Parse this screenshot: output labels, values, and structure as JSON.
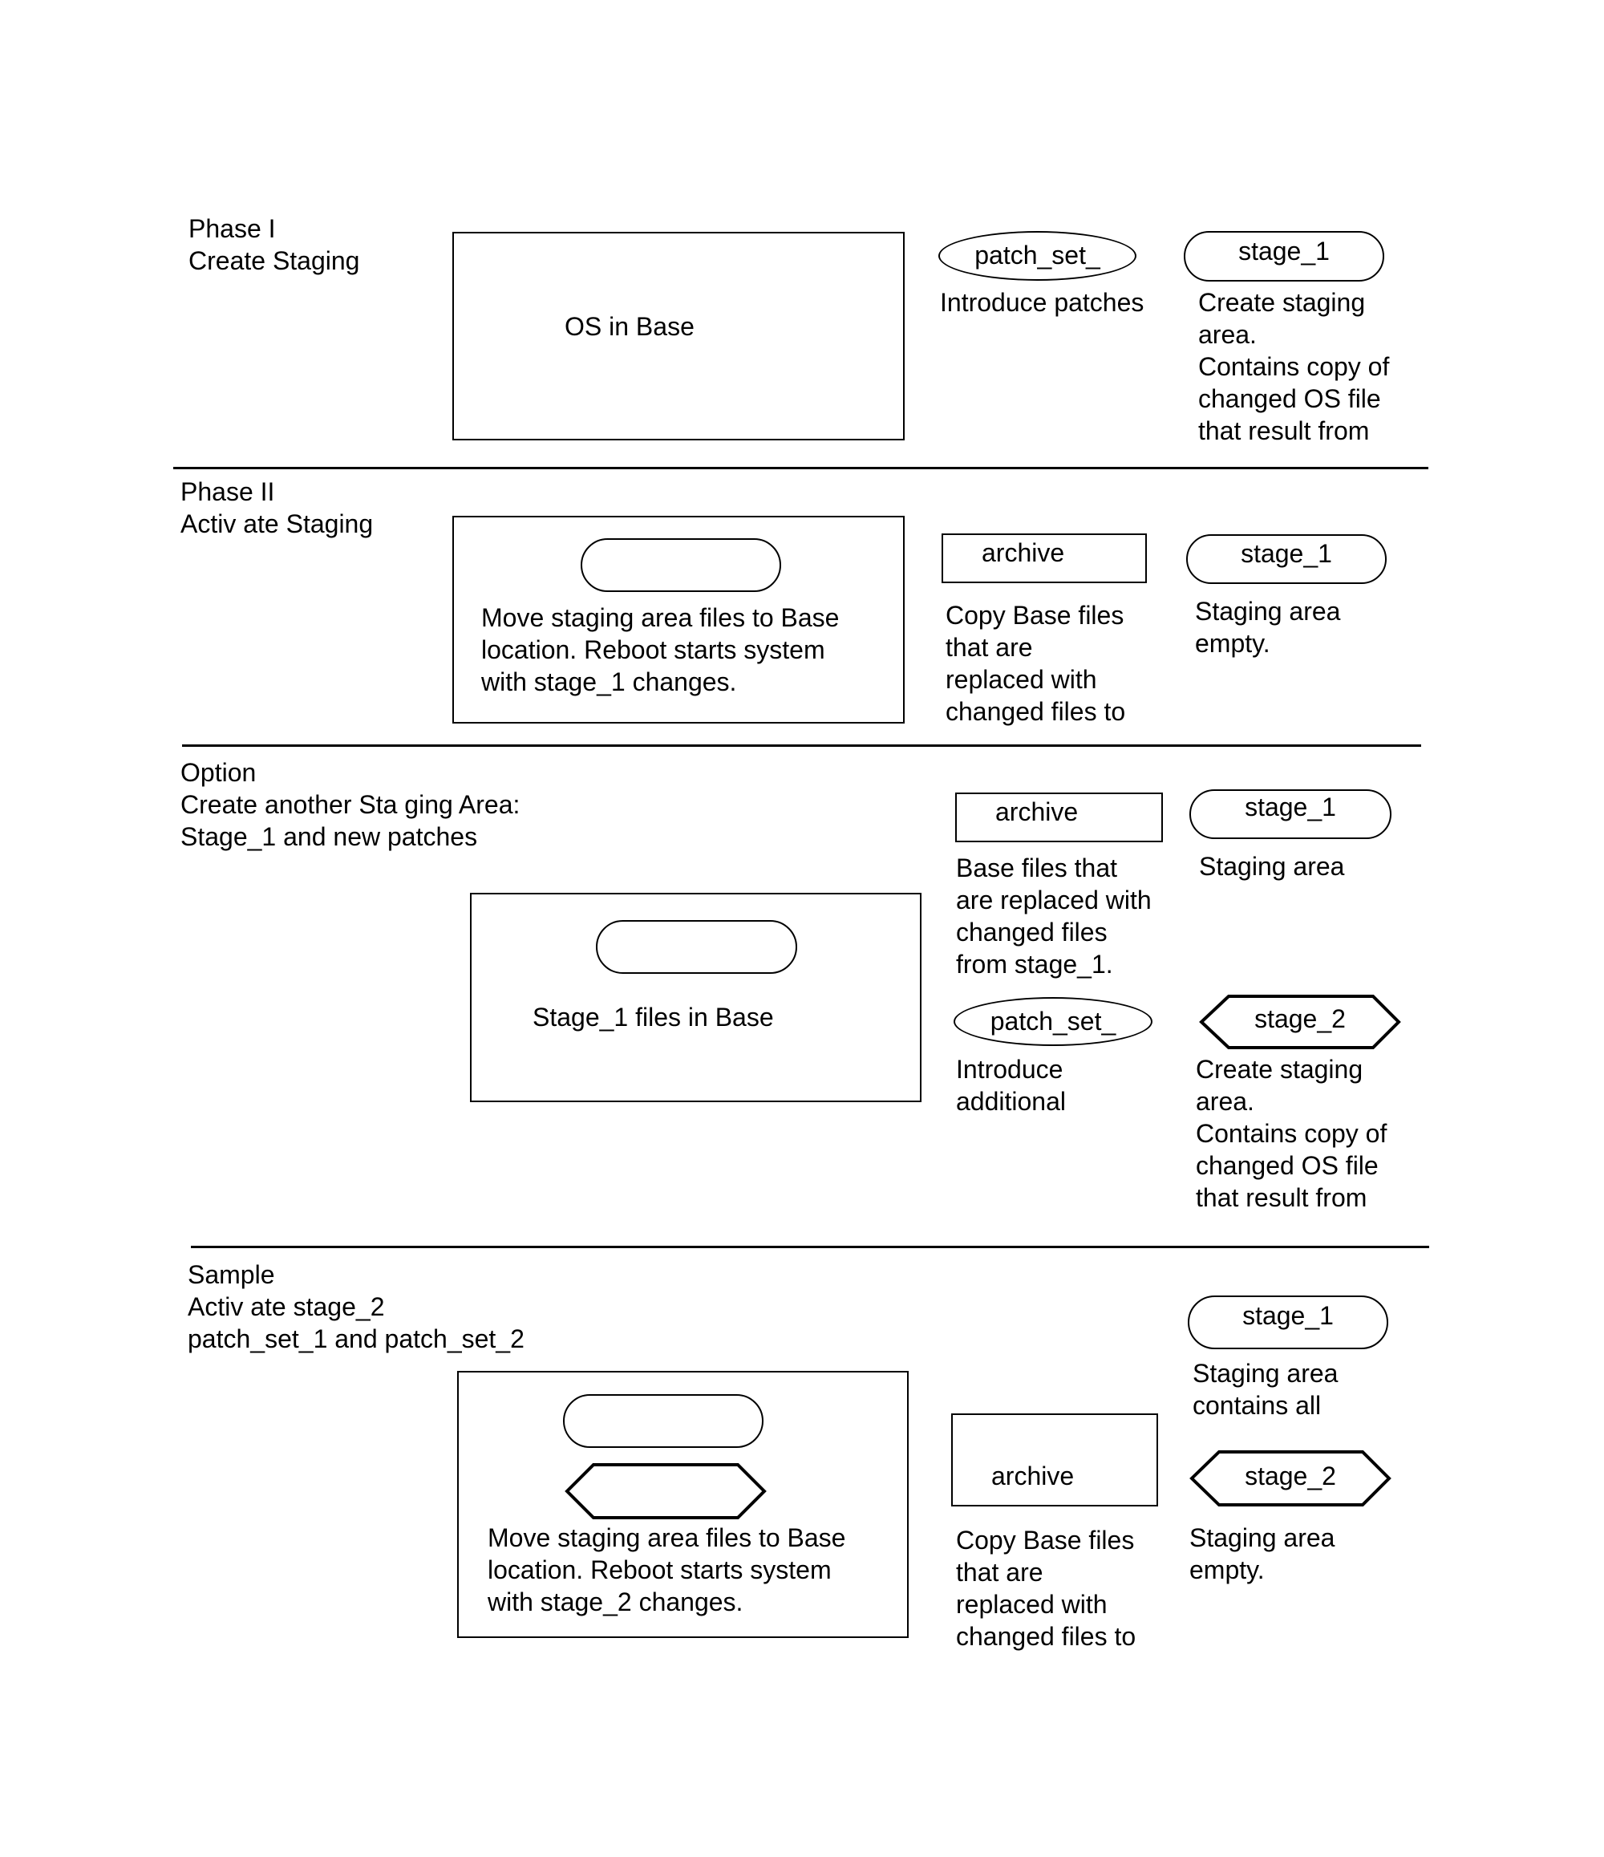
{
  "sections": {
    "phase1": {
      "title": [
        "Phase I",
        "Create Staging"
      ],
      "main_box_label": "OS in Base",
      "patch_set": {
        "label": "patch_set_",
        "description": [
          "Introduce patches"
        ]
      },
      "stage_1": {
        "label": "stage_1",
        "description": [
          "Create staging",
          "area.",
          "Contains copy of",
          "changed OS file",
          "that result from"
        ]
      }
    },
    "phase2": {
      "title": [
        "Phase II",
        "Activ ate Staging"
      ],
      "main_box_text": [
        "Move staging area  files to Base",
        "location.  Reboot starts system",
        "with stage_1 changes."
      ],
      "archive": {
        "label": "archive",
        "description": [
          "Copy Base files",
          "that are",
          "replaced with",
          "changed files to"
        ]
      },
      "stage_1": {
        "label": "stage_1",
        "description": [
          "Staging area",
          "empty."
        ]
      }
    },
    "option": {
      "title": [
        "Option",
        "Create another Sta ging Area:",
        "Stage_1 and new patches"
      ],
      "main_box_label": "Stage_1 files in Base",
      "archive": {
        "label": "archive",
        "description": [
          "Base files that",
          "are replaced with",
          "changed files",
          "from stage_1."
        ]
      },
      "stage_1": {
        "label": "stage_1",
        "description": [
          "Staging area"
        ]
      },
      "patch_set": {
        "label": "patch_set_",
        "description": [
          "Introduce",
          "additional"
        ]
      },
      "stage_2": {
        "label": "stage_2",
        "description": [
          "Create staging",
          "area.",
          "Contains copy of",
          "changed OS file",
          "that result from"
        ]
      }
    },
    "sample": {
      "title": [
        "Sample",
        "Activ ate stage_2",
        "patch_set_1 and patch_set_2"
      ],
      "main_box_text": [
        "Move staging area  files to Base",
        "location.  Reboot starts system",
        "with stage_2 changes."
      ],
      "stage_1": {
        "label": "stage_1",
        "description": [
          "Staging area",
          "contains all"
        ]
      },
      "archive": {
        "label": "archive",
        "description": [
          "Copy Base files",
          "that are",
          "replaced with",
          "changed files to"
        ]
      },
      "stage_2": {
        "label": "stage_2",
        "description": [
          "Staging area",
          "empty."
        ]
      }
    }
  }
}
